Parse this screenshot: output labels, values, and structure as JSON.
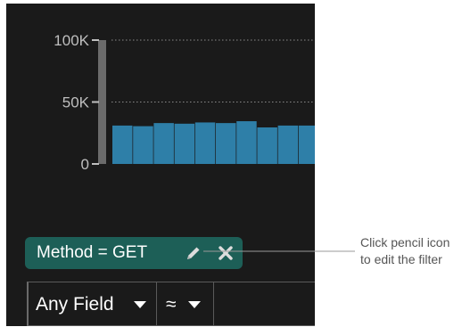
{
  "chart_data": {
    "type": "bar",
    "y_ticks": [
      {
        "value": 100000,
        "label": "100K"
      },
      {
        "value": 50000,
        "label": "50K"
      },
      {
        "value": 0,
        "label": "0"
      }
    ],
    "ylim": [
      0,
      100000
    ],
    "values": [
      31000,
      30500,
      33000,
      32500,
      33500,
      33000,
      34500,
      29500,
      31000,
      31000
    ],
    "bar_color": "#2e7fa8",
    "scrubber_color": "#6b6b6b",
    "grid": "dotted"
  },
  "filter": {
    "label": "Method = GET",
    "pencil_icon": "pencil-icon",
    "close_icon": "close-icon",
    "background": "#1d5f57"
  },
  "query_bar": {
    "field_selected": "Any Field",
    "operator_selected": "≈",
    "value": ""
  },
  "callout": {
    "line1": "Click pencil icon",
    "line2": "to edit the filter"
  }
}
